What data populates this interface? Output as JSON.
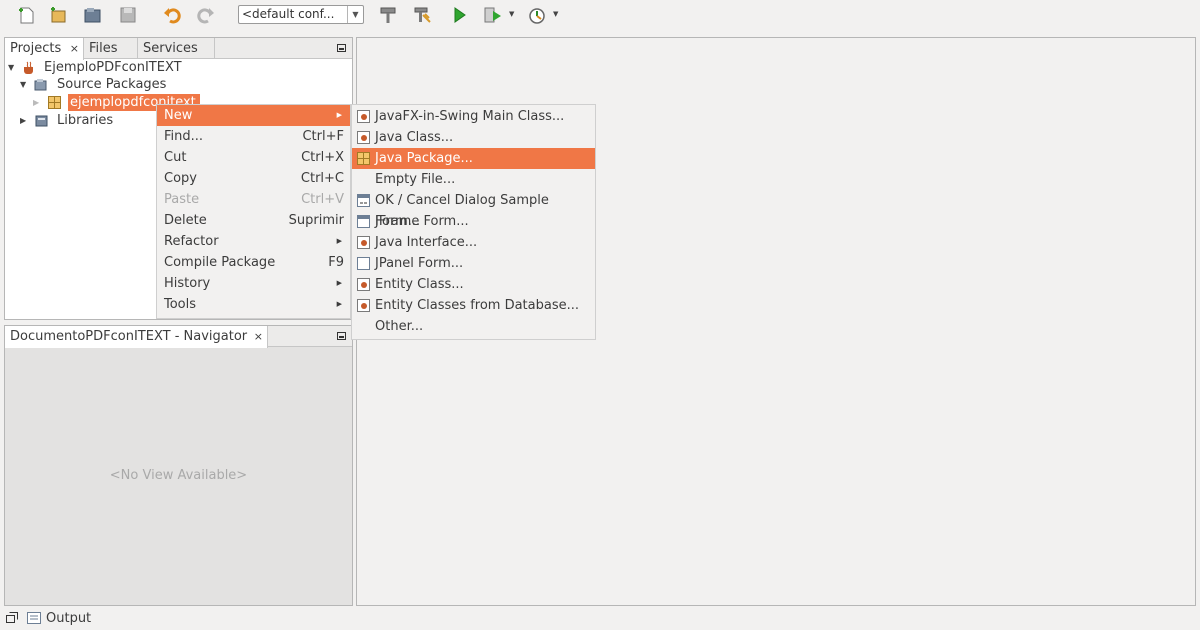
{
  "toolbar": {
    "config_value": "<default conf..."
  },
  "projects_panel": {
    "tabs": [
      {
        "label": "Projects",
        "close": "×"
      },
      {
        "label": "Files"
      },
      {
        "label": "Services"
      }
    ],
    "tree": {
      "project": "EjemploPDFconITEXT",
      "source_packages": "Source Packages",
      "package": "ejemplopdfconitext",
      "libraries": "Libraries"
    }
  },
  "navigator_panel": {
    "tab_label": "DocumentoPDFconITEXT - Navigator",
    "close": "×",
    "empty_text": "<No View Available>"
  },
  "status_bar": {
    "output_label": "Output"
  },
  "context_menu": {
    "items": [
      {
        "label": "New",
        "shortcut": "",
        "submenu": true,
        "state": "highlighted"
      },
      {
        "label": "Find...",
        "shortcut": "Ctrl+F"
      },
      {
        "label": "Cut",
        "shortcut": "Ctrl+X"
      },
      {
        "label": "Copy",
        "shortcut": "Ctrl+C"
      },
      {
        "label": "Paste",
        "shortcut": "Ctrl+V",
        "state": "disabled"
      },
      {
        "label": "Delete",
        "shortcut": "Suprimir"
      },
      {
        "label": "Refactor",
        "shortcut": "",
        "submenu": true
      },
      {
        "label": "Compile Package",
        "shortcut": "F9"
      },
      {
        "label": "History",
        "shortcut": "",
        "submenu": true
      },
      {
        "label": "Tools",
        "shortcut": "",
        "submenu": true
      }
    ]
  },
  "submenu": {
    "items": [
      {
        "label": "JavaFX-in-Swing Main Class...",
        "icon": "java-class-icon"
      },
      {
        "label": "Java Class...",
        "icon": "java-class-icon"
      },
      {
        "label": "Java Package...",
        "icon": "package-icon",
        "state": "highlighted"
      },
      {
        "label": "Empty File...",
        "icon": "empty-file-icon"
      },
      {
        "label": "OK / Cancel Dialog Sample Form...",
        "icon": "dialog-form-icon"
      },
      {
        "label": "JFrame Form...",
        "icon": "frame-form-icon"
      },
      {
        "label": "Java Interface...",
        "icon": "java-class-icon"
      },
      {
        "label": "JPanel Form...",
        "icon": "panel-form-icon"
      },
      {
        "label": "Entity Class...",
        "icon": "java-class-icon"
      },
      {
        "label": "Entity Classes from Database...",
        "icon": "java-class-icon"
      },
      {
        "label": "Other...",
        "icon": ""
      }
    ]
  },
  "colors": {
    "highlight": "#f07746",
    "window_bg": "#f2f1f0",
    "disabled_text": "#a9a9a9"
  }
}
